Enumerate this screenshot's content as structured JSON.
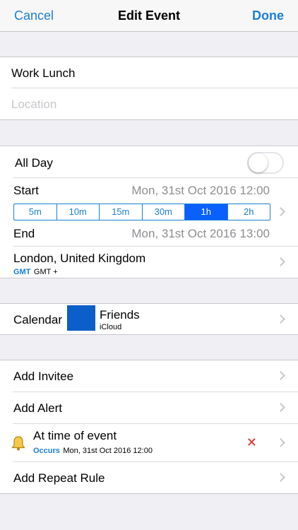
{
  "navbar": {
    "cancel": "Cancel",
    "title": "Edit Event",
    "done": "Done"
  },
  "event": {
    "title": "Work Lunch",
    "location_placeholder": "Location"
  },
  "all_day": {
    "label": "All Day",
    "enabled": false
  },
  "start": {
    "label": "Start",
    "value": "Mon, 31st Oct 2016 12:00"
  },
  "duration_options": [
    "5m",
    "10m",
    "15m",
    "30m",
    "1h",
    "2h"
  ],
  "duration_selected": "1h",
  "end": {
    "label": "End",
    "value": "Mon, 31st Oct 2016 13:00"
  },
  "timezone": {
    "name": "London, United Kingdom",
    "tz_abbrev": "GMT",
    "tz_offset": "GMT +"
  },
  "calendar": {
    "label": "Calendar",
    "name": "Friends",
    "account": "iCloud",
    "color": "#0c5ec9"
  },
  "invitee": {
    "label": "Add Invitee"
  },
  "alert": {
    "label": "Add Alert"
  },
  "alert_item": {
    "title": "At time of event",
    "occurs_label": "Occurs",
    "occurs_value": "Mon, 31st Oct 2016 12:00"
  },
  "repeat": {
    "label": "Add Repeat Rule"
  },
  "colors": {
    "accent": "#1a7fd4",
    "selected": "#0a60ff",
    "delete": "#e0261f"
  }
}
